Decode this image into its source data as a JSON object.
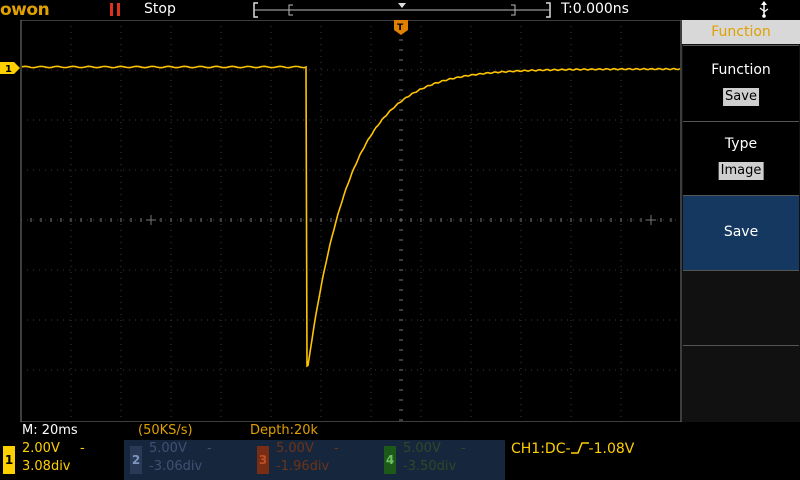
{
  "header": {
    "logo_text": "OWON",
    "run_state": "Stop",
    "time_offset": "T:0.000ns"
  },
  "menu": {
    "title": "Function",
    "items": [
      {
        "label": "Function",
        "value": "Save"
      },
      {
        "label": "Type",
        "value": "Image"
      },
      {
        "label": "Save",
        "value": ""
      }
    ]
  },
  "status": {
    "timebase": "M: 20ms",
    "sample_rate": "(50KS/s)",
    "depth": "Depth:20k"
  },
  "channels": [
    {
      "num": "1",
      "volts": "2.00V",
      "position": "3.08div",
      "coupling": "-"
    },
    {
      "num": "2",
      "volts": "5.00V",
      "position": "-3.06div",
      "coupling": "-"
    },
    {
      "num": "3",
      "volts": "5.00V",
      "position": "-1.96div",
      "coupling": "-"
    },
    {
      "num": "4",
      "volts": "5.00V",
      "position": "-3.50div",
      "coupling": "-"
    }
  ],
  "trigger": {
    "source": "CH1:DC-",
    "level": "-1.08V"
  },
  "markers": {
    "ch1": "1",
    "trigger": "T"
  },
  "colors": {
    "ch1": "#ffd000",
    "accent": "#e0a000",
    "menu_selected": "#14385f"
  }
}
